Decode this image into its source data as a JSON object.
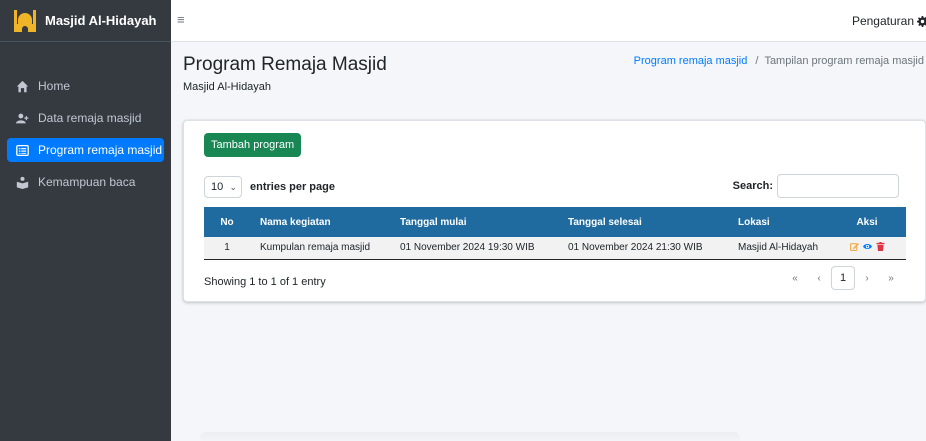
{
  "brand": {
    "name": "Masjid Al-Hidayah"
  },
  "sidebar": {
    "items": [
      {
        "label": "Home",
        "icon": "home-icon"
      },
      {
        "label": "Data remaja masjid",
        "icon": "user-plus-icon"
      },
      {
        "label": "Program remaja masjid",
        "icon": "list-icon",
        "active": true
      },
      {
        "label": "Kemampuan baca",
        "icon": "reader-icon"
      }
    ]
  },
  "topbar": {
    "settings_label": "Pengaturan"
  },
  "header": {
    "title": "Program Remaja Masjid",
    "subtitle": "Masjid Al-Hidayah",
    "breadcrumb": {
      "link": "Program remaja masjid",
      "separator": "/",
      "current": "Tampilan program remaja masjid"
    }
  },
  "card": {
    "add_button": "Tambah program",
    "length": {
      "value": "10",
      "label": "entries per page"
    },
    "search": {
      "label": "Search:",
      "value": ""
    },
    "table": {
      "headers": [
        "No",
        "Nama kegiatan",
        "Tanggal mulai",
        "Tanggal selesai",
        "Lokasi",
        "Aksi"
      ],
      "rows": [
        [
          "1",
          "Kumpulan remaja masjid",
          "01 November 2024 19:30 WIB",
          "01 November 2024 21:30 WIB",
          "Masjid Al-Hidayah"
        ]
      ]
    },
    "info": "Showing 1 to 1 of 1 entry",
    "pagination": {
      "first": "«",
      "prev": "‹",
      "current": "1",
      "next": "›",
      "last": "»"
    }
  },
  "colors": {
    "sidebar": "#343a40",
    "active": "#007bff",
    "add_button": "#198754",
    "table_header": "#1f6a9e",
    "edit": "#f0ad4e",
    "view": "#007bff",
    "delete": "#dc3545"
  }
}
